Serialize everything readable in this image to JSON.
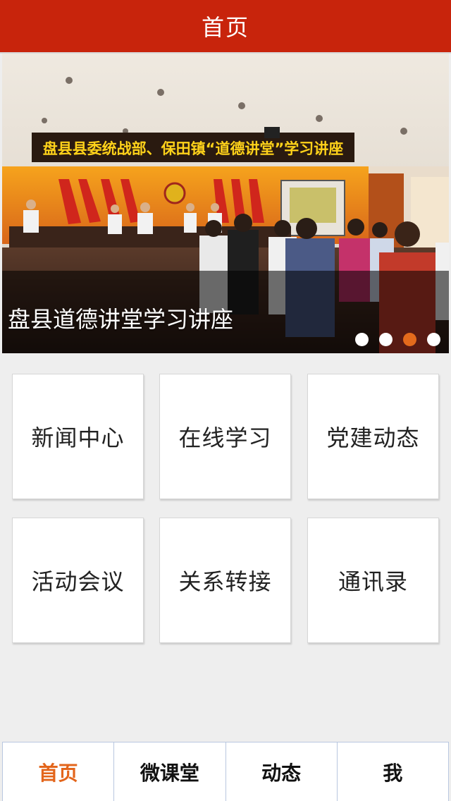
{
  "header": {
    "title": "首页"
  },
  "banner": {
    "photo_banner_text": "盘县县委统战部、保田镇“道德讲堂”学习讲座",
    "caption": "盘县道德讲堂学习讲座",
    "slide_count": 4,
    "active_slide": 3
  },
  "menu": {
    "tiles": [
      {
        "label": "新闻中心"
      },
      {
        "label": "在线学习"
      },
      {
        "label": "党建动态"
      },
      {
        "label": "活动会议"
      },
      {
        "label": "关系转接"
      },
      {
        "label": "通讯录"
      }
    ]
  },
  "tabbar": {
    "tabs": [
      {
        "label": "首页",
        "active": true
      },
      {
        "label": "微课堂",
        "active": false
      },
      {
        "label": "动态",
        "active": false
      },
      {
        "label": "我",
        "active": false
      }
    ]
  },
  "colors": {
    "header_red": "#c8240c",
    "accent_orange": "#e36a1c",
    "background": "#eeeeee"
  }
}
